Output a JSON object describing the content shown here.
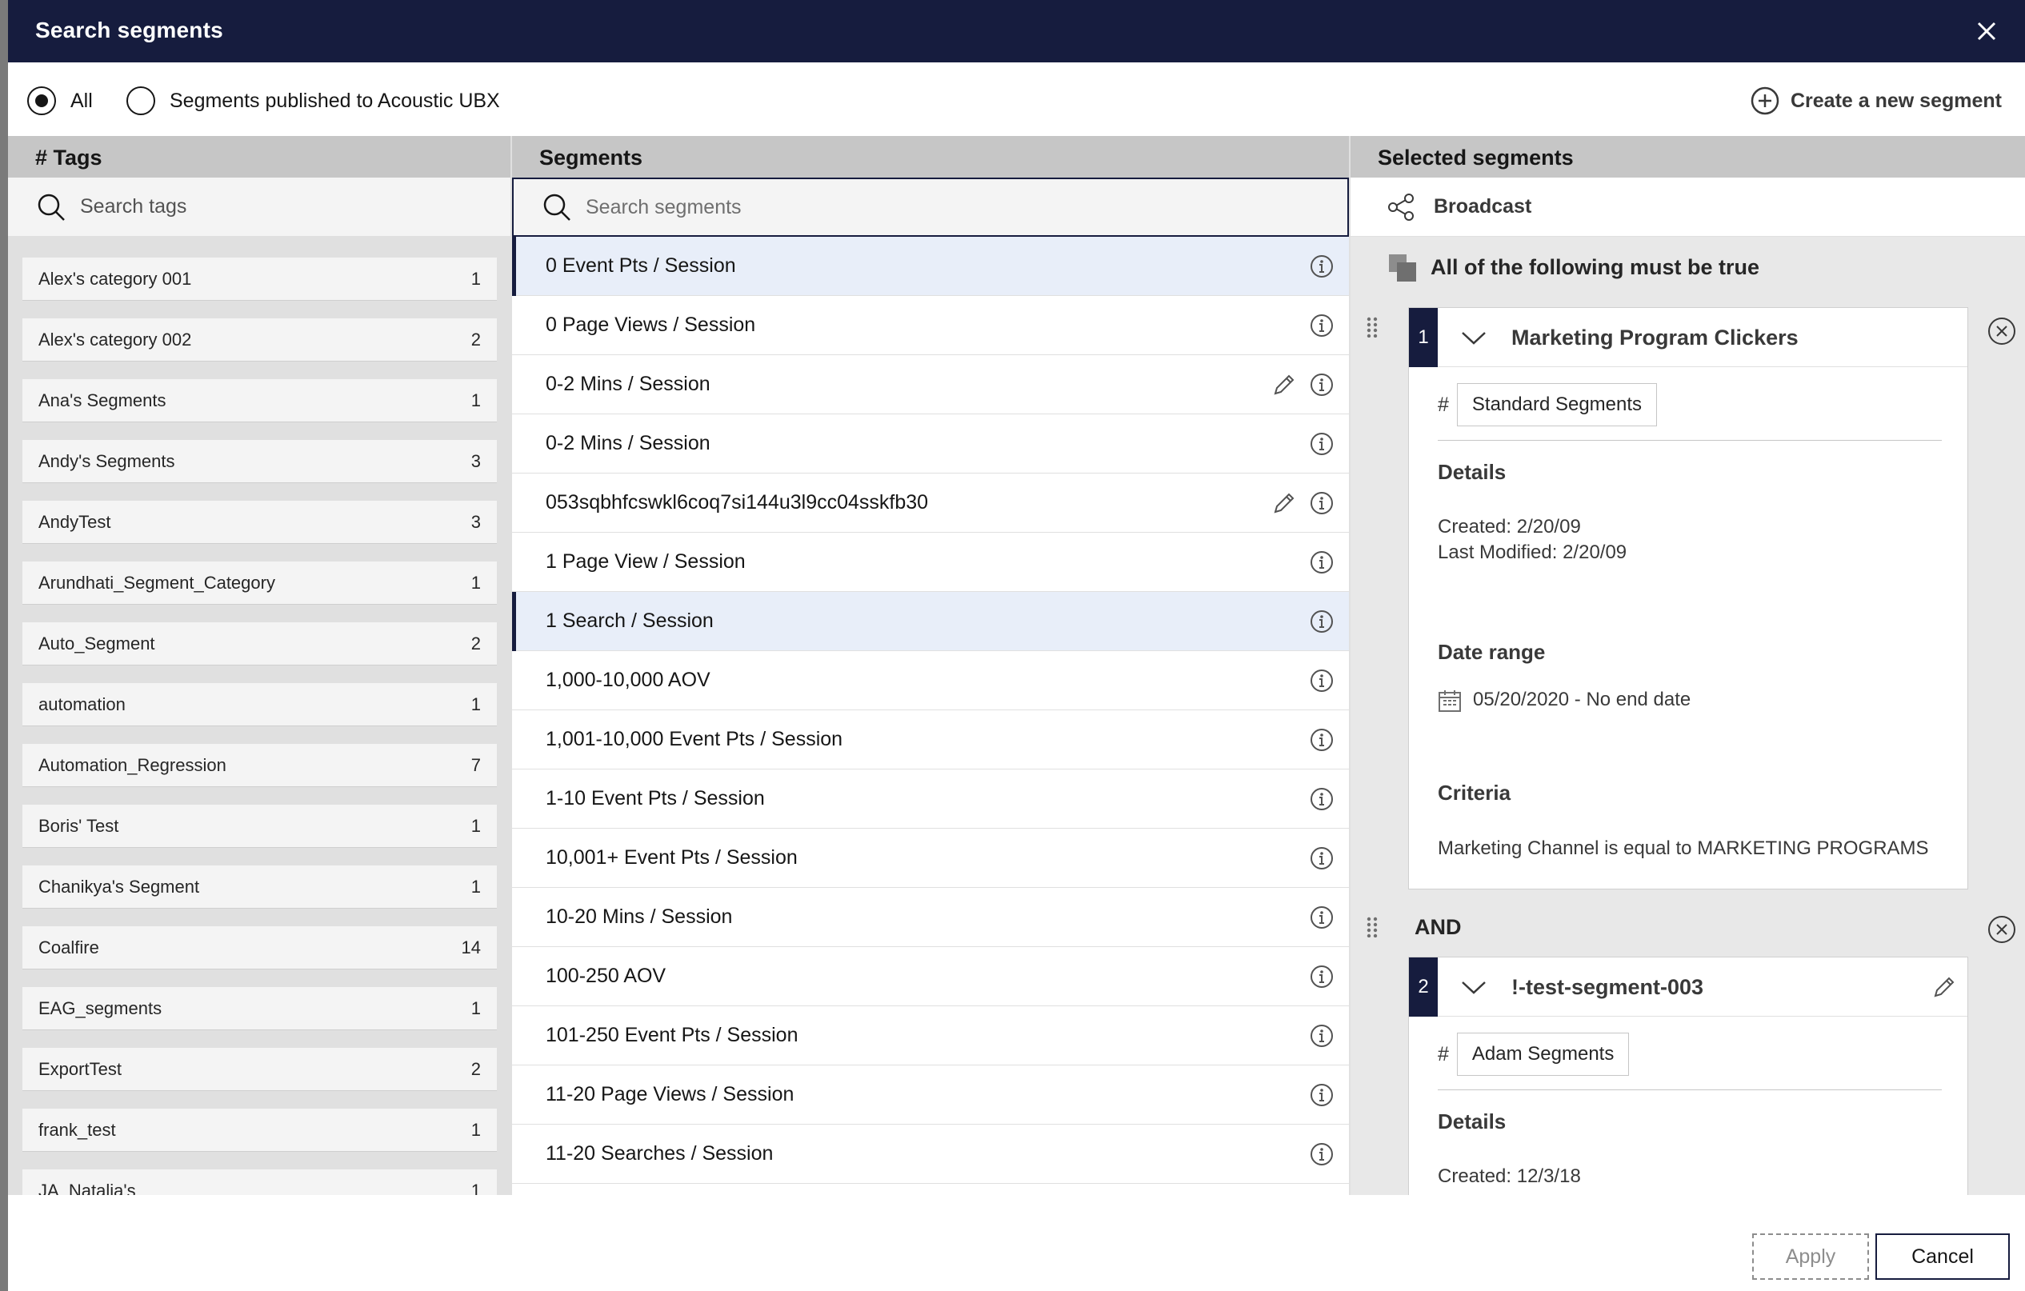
{
  "dialog": {
    "title": "Search segments",
    "close_icon": "close-icon"
  },
  "filter": {
    "all_label": "All",
    "published_label": "Segments published to Acoustic UBX",
    "selected": "All",
    "create_label": "Create a new segment"
  },
  "tags": {
    "header": "# Tags",
    "search_placeholder": "Search tags",
    "items": [
      {
        "label": "Alex's category 001",
        "count": "1"
      },
      {
        "label": "Alex's category 002",
        "count": "2"
      },
      {
        "label": "Ana's Segments",
        "count": "1"
      },
      {
        "label": "Andy's Segments",
        "count": "3"
      },
      {
        "label": "AndyTest",
        "count": "3"
      },
      {
        "label": "Arundhati_Segment_Category",
        "count": "1"
      },
      {
        "label": "Auto_Segment",
        "count": "2"
      },
      {
        "label": "automation",
        "count": "1"
      },
      {
        "label": "Automation_Regression",
        "count": "7"
      },
      {
        "label": "Boris' Test",
        "count": "1"
      },
      {
        "label": "Chanikya's Segment",
        "count": "1"
      },
      {
        "label": "Coalfire",
        "count": "14"
      },
      {
        "label": "EAG_segments",
        "count": "1"
      },
      {
        "label": "ExportTest",
        "count": "2"
      },
      {
        "label": "frank_test",
        "count": "1"
      },
      {
        "label": "JA_Natalia's",
        "count": "1"
      }
    ]
  },
  "segments": {
    "header": "Segments",
    "search_placeholder": "Search segments",
    "items": [
      {
        "label": "0 Event Pts / Session",
        "selected": true,
        "editable": false
      },
      {
        "label": "0 Page Views / Session",
        "selected": false,
        "editable": false
      },
      {
        "label": "0-2 Mins / Session",
        "selected": false,
        "editable": true
      },
      {
        "label": "0-2 Mins / Session",
        "selected": false,
        "editable": false
      },
      {
        "label": "053sqbhfcswkl6coq7si144u3l9cc04sskfb30",
        "selected": false,
        "editable": true
      },
      {
        "label": "1 Page View / Session",
        "selected": false,
        "editable": false
      },
      {
        "label": "1 Search / Session",
        "selected": true,
        "editable": false
      },
      {
        "label": "1,000-10,000 AOV",
        "selected": false,
        "editable": false
      },
      {
        "label": "1,001-10,000 Event Pts / Session",
        "selected": false,
        "editable": false
      },
      {
        "label": "1-10 Event Pts / Session",
        "selected": false,
        "editable": false
      },
      {
        "label": "10,001+ Event Pts / Session",
        "selected": false,
        "editable": false
      },
      {
        "label": "10-20 Mins / Session",
        "selected": false,
        "editable": false
      },
      {
        "label": "100-250 AOV",
        "selected": false,
        "editable": false
      },
      {
        "label": "101-250 Event Pts / Session",
        "selected": false,
        "editable": false
      },
      {
        "label": "11-20 Page Views / Session",
        "selected": false,
        "editable": false
      },
      {
        "label": "11-20 Searches / Session",
        "selected": false,
        "editable": false
      }
    ]
  },
  "selected": {
    "header": "Selected segments",
    "broadcast_label": "Broadcast",
    "rule_label": "All of the following must be true",
    "and_label": "AND",
    "cards": [
      {
        "number": "1",
        "title": "Marketing Program Clickers",
        "hash": "#",
        "tag": "Standard Segments",
        "details_label": "Details",
        "created": "Created: 2/20/09",
        "modified": "Last Modified: 2/20/09",
        "date_range_label": "Date range",
        "date_range": "05/20/2020 - No end date",
        "criteria_label": "Criteria",
        "criteria": "Marketing Channel is equal to MARKETING PROGRAMS"
      },
      {
        "number": "2",
        "title": "!-test-segment-003",
        "hash": "#",
        "tag": "Adam Segments",
        "details_label": "Details",
        "created": "Created: 12/3/18"
      }
    ]
  },
  "footer": {
    "apply_label": "Apply",
    "cancel_label": "Cancel"
  },
  "colors": {
    "header_bg": "#161c3e",
    "selected_row": "#e8eef9",
    "column_header": "#c6c6c6"
  }
}
